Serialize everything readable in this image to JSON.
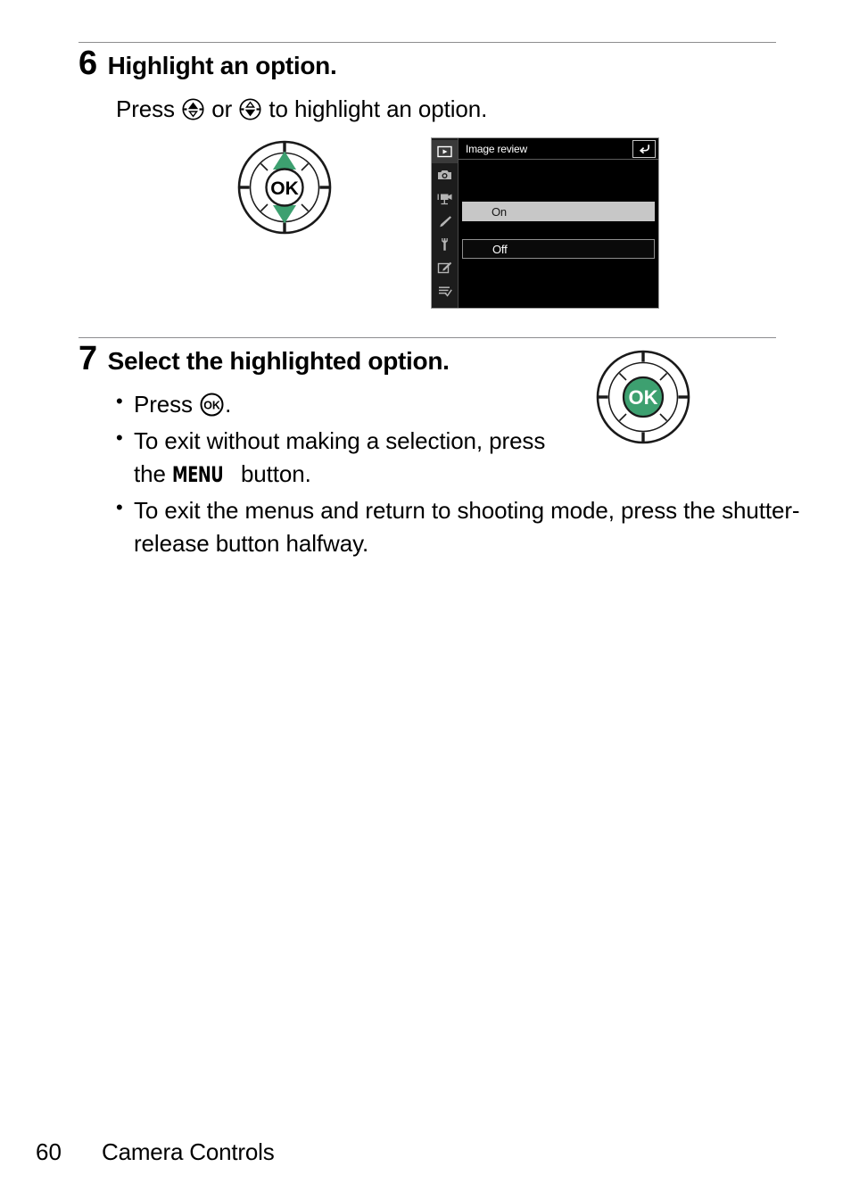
{
  "page": {
    "number": "60",
    "section": "Camera Controls"
  },
  "steps": [
    {
      "number": "6",
      "title": "Highlight an option.",
      "body_before": "Press ",
      "body_mid": " or ",
      "body_after": " to highlight an option."
    },
    {
      "number": "7",
      "title": "Select the highlighted option.",
      "bullets": [
        {
          "before": "Press ",
          "after": "."
        },
        {
          "before": "To exit without making a selection, press the ",
          "button": "MENU",
          "after": " button."
        },
        {
          "before": "To exit the menus and return to shooting mode, press the shutter-release button halfway.",
          "after": ""
        }
      ]
    }
  ],
  "icons": {
    "multi_selector_up": "multi-selector-up-icon",
    "multi_selector_down": "multi-selector-down-icon",
    "ok_button": "ok-button-icon",
    "menu_button": "menu-button-icon"
  },
  "dials": {
    "step6": {
      "name": "multi-selector-dial-up-down",
      "center_label": "OK",
      "center_label_color": "#000000",
      "arrow_color": "#3da070"
    },
    "step7": {
      "name": "multi-selector-dial-ok",
      "center_label": "OK",
      "center_fill": "#3da070",
      "center_label_color": "#ffffff"
    }
  },
  "lcd": {
    "title": "Image review",
    "back_glyph": "↶",
    "tabs": [
      {
        "name": "playback-menu-tab",
        "glyph": "playback",
        "active": true
      },
      {
        "name": "photo-shooting-menu-tab",
        "glyph": "camera",
        "active": false
      },
      {
        "name": "movie-shooting-menu-tab",
        "glyph": "movie",
        "active": false
      },
      {
        "name": "custom-settings-menu-tab",
        "glyph": "pencil",
        "active": false
      },
      {
        "name": "setup-menu-tab",
        "glyph": "wrench",
        "active": false
      },
      {
        "name": "retouch-menu-tab",
        "glyph": "retouch",
        "active": false
      },
      {
        "name": "recent-settings-menu-tab",
        "glyph": "recent",
        "active": false
      }
    ],
    "options": [
      {
        "label": "On",
        "selected": true
      },
      {
        "label": "Off",
        "selected": false
      }
    ]
  },
  "colors": {
    "accent_green": "#3da070",
    "rule": "#8d8d8f",
    "lcd_highlight": "#c7c7c7",
    "lcd_background": "#000000",
    "lcd_sidebar": "#1c1c1c"
  }
}
